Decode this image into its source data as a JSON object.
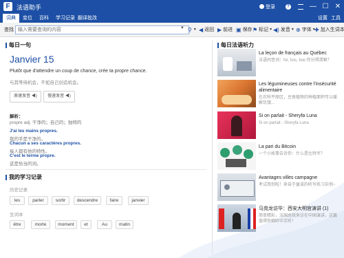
{
  "app": {
    "title": "法语助手",
    "logo": "F"
  },
  "titlebar": {
    "login": "登录",
    "help_icon": "help-icon",
    "menu_icon": "menu-icon",
    "minimize": "—",
    "maximize": "☐",
    "close": "✕"
  },
  "tabs": [
    "词典",
    "变位",
    "百科",
    "学习记录",
    "翻译批改"
  ],
  "tabs_right": {
    "settings": "设置",
    "tools": "工具"
  },
  "search": {
    "label": "查找",
    "placeholder": "输入需要查询的内容"
  },
  "toolbar": {
    "back": "返回",
    "forward": "前进",
    "save": "保存",
    "notes": "标记",
    "speak": "发音",
    "font": "字体",
    "add_notebook": "加入生词本"
  },
  "daily": {
    "section_title": "每日一句",
    "date": "Janvier 15",
    "quote": "Plutôt que d'attendre un coup de chance, crée ta propre chance.",
    "translation": "与其等待机会，不如自己创造机会。",
    "btn_standard": "原速发音",
    "btn_slow": "慢速发音",
    "explain_title": "解析：",
    "explain_line": "propre adj. 干净的；自己的；独特的",
    "examples": [
      {
        "fr": "J'ai les mains propres.",
        "zh": "我的手是干净的。"
      },
      {
        "fr": "Chacun a ses caractères propres.",
        "zh": "每人都有他的特性。"
      },
      {
        "fr": "C'est le terme propre.",
        "zh": "这是恰当的词。"
      }
    ]
  },
  "records": {
    "section_title": "我的学习记录",
    "history_label": "历史记录",
    "history": [
      "les",
      "parler",
      "sortir",
      "descendre",
      "faire",
      "janvier"
    ],
    "notebook_label": "生词本",
    "notebook": [
      "être",
      "morte",
      "moment",
      "et",
      "Au",
      "matin"
    ]
  },
  "listening": {
    "section_title": "每日法语听力",
    "items": [
      {
        "title": "La leçon de français au Québec",
        "sub": "法语同音词：foi, fois, foie 你分得清嘛？"
      },
      {
        "title": "Les légumineuses contre l'insécurité alimentaire",
        "sub": "在农科平原区，豆类植物的种植面积可以缓解饥饿..."
      },
      {
        "title": "Si on parlait - Sheryfa Luna",
        "sub": "Si on parlait - Sheryfa Luna"
      },
      {
        "title": "La pari du Bitcoin",
        "sub": "一个小故事告诉你：什么是比特币？"
      },
      {
        "title": "Avantages villes campagne",
        "sub": "考试用到啦！来自于童谣的听写练习实例~"
      },
      {
        "title": "马克龙访华：西安大明宫演讲 (1)",
        "sub": "简单精彩，法国总统来访在中国演讲，这篇值得你细听中文听！"
      }
    ]
  }
}
